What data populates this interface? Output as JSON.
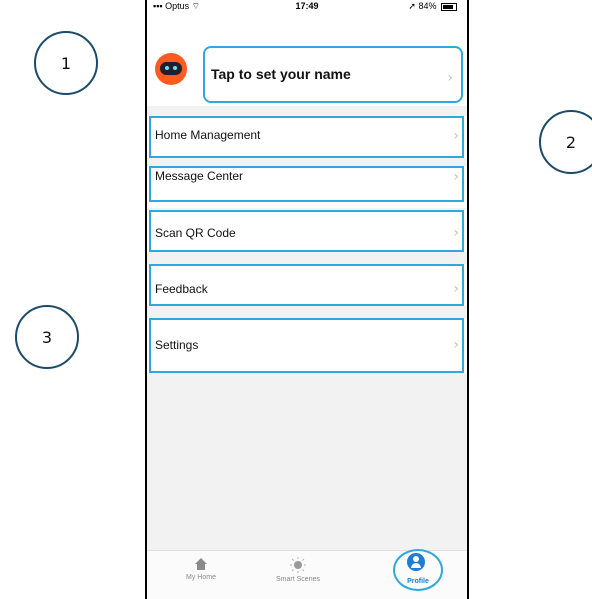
{
  "annotations": {
    "one": "1",
    "two": "2",
    "three": "3"
  },
  "status_bar": {
    "carrier": "Optus",
    "time": "17:49",
    "battery": "84%"
  },
  "profile": {
    "name_prompt": "Tap to set your name"
  },
  "menu": {
    "items": [
      {
        "label": "Home Management"
      },
      {
        "label": "Message Center"
      },
      {
        "label": "Scan QR Code"
      },
      {
        "label": "Feedback"
      },
      {
        "label": "Settings"
      }
    ]
  },
  "tabs": [
    {
      "label": "My Home",
      "icon": "home-icon"
    },
    {
      "label": "Smart Scenes",
      "icon": "sun-icon"
    },
    {
      "label": "Profile",
      "icon": "profile-icon"
    }
  ],
  "colors": {
    "highlight": "#2ea8dd",
    "active_tab": "#1e7bd6",
    "avatar": "#ff5a1f"
  }
}
